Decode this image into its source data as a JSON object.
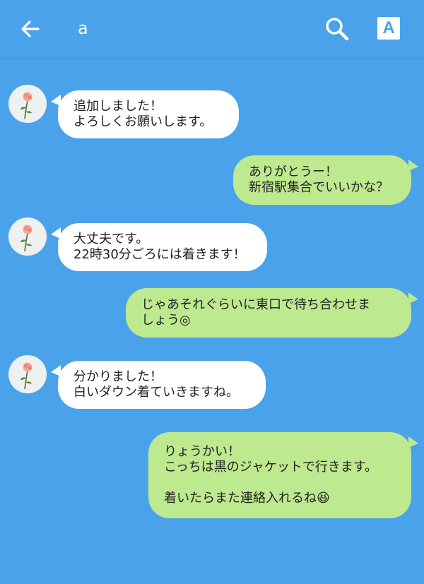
{
  "header": {
    "title": "a",
    "back_icon": "arrow-left-icon",
    "search_icon": "search-icon",
    "font_button_label": "A"
  },
  "colors": {
    "background": "#4aa3ea",
    "incoming_bubble": "#ffffff",
    "outgoing_bubble": "#bde98f"
  },
  "messages": [
    {
      "sender": "other",
      "text": "追加しました！\nよろしくお願いします。"
    },
    {
      "sender": "me",
      "text": "ありがとうー！\n新宿駅集合でいいかな？"
    },
    {
      "sender": "other",
      "text": "大丈夫です。\n22時30分ごろには着きます！"
    },
    {
      "sender": "me",
      "text": "じゃあそれぐらいに東口で待ち合わせま\nしょう◎"
    },
    {
      "sender": "other",
      "text": "分かりました！\n白いダウン着ていきますね。"
    },
    {
      "sender": "me",
      "text": "りょうかい！\nこっちは黒のジャケットで行きます。\n\n着いたらまた連絡入れるね😆"
    }
  ]
}
